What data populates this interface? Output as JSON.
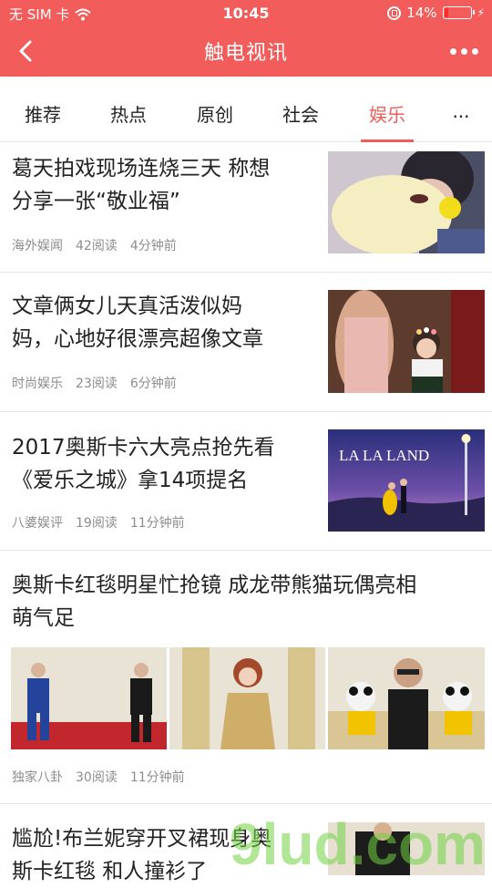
{
  "status": {
    "carrier": "无 SIM 卡",
    "time": "10:45",
    "battery": "14%",
    "battery_level": 0.14
  },
  "nav": {
    "title": "触电视讯",
    "back_icon": "chevron-left-icon",
    "more_icon": "more-dots-icon"
  },
  "tabs": [
    "推荐",
    "热点",
    "原创",
    "社会",
    "娱乐",
    "..."
  ],
  "active_tab_index": 4,
  "colors": {
    "brand": "#f25c5a",
    "meta_text": "#8c8c8c",
    "title_text": "#222222"
  },
  "articles": [
    {
      "title_line1": "葛天拍戏现场连烧三天 称想",
      "title_line2": "分享一张“敬业福”",
      "source": "海外娱闻",
      "reads": "42阅读",
      "time": "4分钟前"
    },
    {
      "title_line1": "文章俩女儿天真活泼似妈",
      "title_line2": "妈，心地好很漂亮超像文章",
      "source": "时尚娱乐",
      "reads": "23阅读",
      "time": "6分钟前"
    },
    {
      "title_line1": "2017奥斯卡六大亮点抢先看",
      "title_line2": "《爱乐之城》拿14项提名",
      "source": "八婆娱评",
      "reads": "19阅读",
      "time": "11分钟前",
      "thumb_text": "LA LA LAND"
    },
    {
      "title_line1": "奥斯卡红毯明星忙抢镜 成龙带熊猫玩偶亮相",
      "title_line2": "萌气足",
      "source": "独家八卦",
      "reads": "30阅读",
      "time": "11分钟前"
    },
    {
      "title_line1": "尴尬!布兰妮穿开叉裙现身奥",
      "title_line2": "斯卡红毯 和人撞衫了"
    }
  ],
  "watermark": "9lud.com"
}
